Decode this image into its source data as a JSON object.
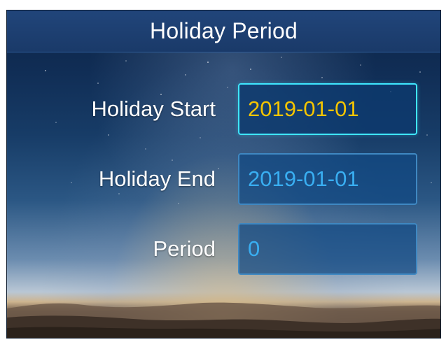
{
  "title": "Holiday Period",
  "fields": [
    {
      "label": "Holiday Start",
      "value": "2019-01-01",
      "active": true
    },
    {
      "label": "Holiday End",
      "value": "2019-01-01",
      "active": false
    },
    {
      "label": "Period",
      "value": "0",
      "active": false
    }
  ],
  "colors": {
    "title_bar": "#1d3f70",
    "label_text": "#ffffff",
    "active_value": "#f4c400",
    "inactive_value": "#39aef1",
    "active_border": "#3fe7ff",
    "inactive_border": "#3f88c2"
  }
}
